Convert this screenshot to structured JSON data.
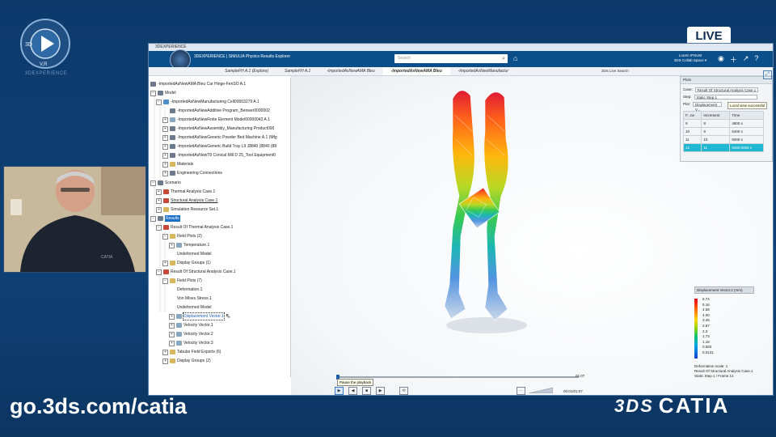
{
  "stream": {
    "live_label": "LIVE",
    "promo_url": "go.3ds.com/catia",
    "catia_logo": "CATIA",
    "ds_mark": "3DS",
    "brand_caption": "3DEXPERIENCE",
    "brand_logo_letters": [
      "3D",
      "V,R"
    ]
  },
  "app": {
    "window_title": "3DEXPERIENCE",
    "app_label": "3DEXPERIENCE | SIMULIA Physics Results Explorer",
    "search_placeholder": "Search",
    "user_name": "Lorem IPSUM",
    "user_space": "3DS Collab Space ▾",
    "tabs": [
      {
        "label": "SampleFH A.1 (Explore)"
      },
      {
        "label": "SampleFH A.1"
      },
      {
        "label": "-ImportedAsNewAMA Bleu"
      },
      {
        "label": "-ImportedAsNewAMA Bleu",
        "active": true
      },
      {
        "label": "-ImportedAsNewManufactur"
      }
    ],
    "live_search_label": "3DS Live Search",
    "tree": {
      "root": "-ImportedAsNewAMA Bleu Car Hinge-FenSO A.1",
      "model": "Model",
      "items": [
        "-ImportedAsNewManufacturing Cell00003279 A.1",
        "-ImportedAsNewAdditive Program_Benwer0000002",
        "-ImportedAsNewFinite Element Model00000042 A.1",
        "-ImportedAsNewAssembly_Manufacturing Product000",
        "-ImportedAsNewGeneric Powder Bed Machine A.1 (Mfg",
        "-ImportedAsNewGeneric Build Tray L9 J8840 (8840 (88",
        "-ImportedAsNewT8 Conical Mill D 25_Tool Equipment0",
        "Materials",
        "Engineering Connections"
      ],
      "scenario": "Scenario",
      "scenario_items": [
        "Thermal Analysis Case.1",
        "Structural Analysis Case.1",
        "Simulation Resource Set.1"
      ],
      "results": "Results",
      "thermal_result": "Result Of Thermal Analysis Case.1",
      "thermal_field_plots": "Field Plots (2)",
      "thermal_plots": [
        "Temperature.1",
        "Undeformed Model"
      ],
      "thermal_display_groups": "Display Groups (1)",
      "structural_result": "Result Of Structural Analysis Case.1",
      "structural_field_plots": "Field Plots (7)",
      "structural_plots": [
        "Deformation.1",
        "Von Mises Stress.1",
        "Undeformed Model",
        "Displacement Vector.1",
        "Velocity Vector.1",
        "Velocity Vector.2",
        "Velocity Vector.3"
      ],
      "tabular_exports": "Tabular Field Exports (6)",
      "display_groups": "Display Groups (2)"
    },
    "plots_panel": {
      "title": "Plots",
      "case_label": "Case:",
      "case_value": "Result Of Structural Analysis Case.1",
      "step_label": "Step:",
      "step_value": "Static Step.1",
      "plot_label": "Plot:",
      "plot_value": "Displacement V...",
      "tooltip": "Local view successful",
      "columns": [
        "F...ne",
        "Increment",
        "Time"
      ],
      "rows": [
        [
          "9",
          "8",
          "4800 s"
        ],
        [
          "10",
          "9",
          "5400 s"
        ],
        [
          "11",
          "10",
          "6000 s"
        ],
        [
          "12",
          "11",
          "6250.0006 s"
        ]
      ],
      "highlighted_row": 3
    },
    "legend": {
      "title": "Displacement Vector.2 (mm)",
      "ticks": [
        "6.74",
        "5.16",
        "4.58",
        "4.00",
        "3.45",
        "2.87",
        "2.3",
        "1.73",
        "1.16",
        "0.583",
        "0.0131"
      ],
      "deformation_scale": "Deformation scale: 1",
      "result_name": "Result Of Structural Analysis Case.1",
      "frame": "Static Step.1 / Frame 12"
    },
    "playback": {
      "tooltip": "Pause the playback",
      "time_end": "01:07",
      "time_current": "00:01/01:07"
    }
  },
  "colors": {
    "frame_bg": "#0f3d6e",
    "app_topbar": "#0b4f8a",
    "selection": "#1a6fc6",
    "highlight_row": "#20b7d0"
  }
}
